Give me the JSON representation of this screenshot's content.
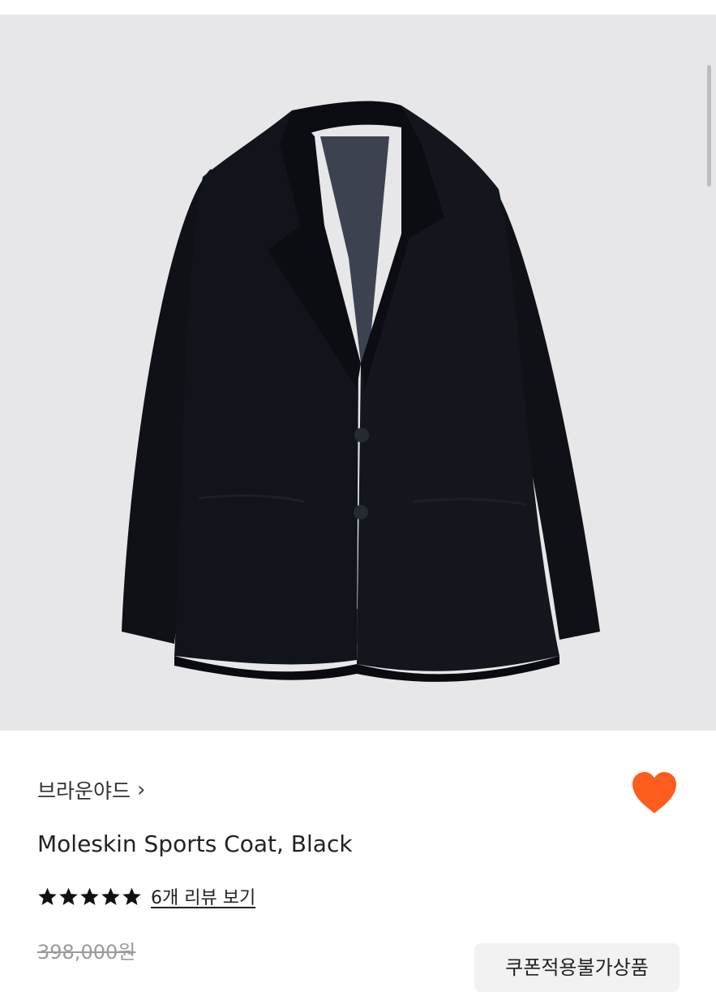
{
  "product": {
    "brand": "브라운야드",
    "brand_chevron": "›",
    "title": "Moleskin Sports Coat, Black",
    "rating_stars": 5,
    "review_link": "6개 리뷰 보기",
    "original_price": "398,000원",
    "coupon_badge": "쿠폰적용불가상품"
  },
  "icons": {
    "heart": "heart-icon",
    "star": "star-icon",
    "chevron": "chevron-right-icon"
  },
  "colors": {
    "heart": "#fc5d1c",
    "image_bg": "#e7e7e9",
    "badge_bg": "#f2f2f3"
  }
}
